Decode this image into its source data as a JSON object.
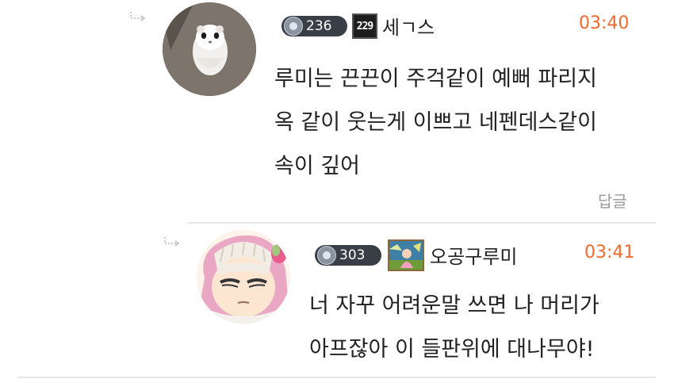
{
  "comments": [
    {
      "level": "236",
      "icon_badge_text": "229",
      "nickname": "세ㄱ스",
      "time": "03:40",
      "lines": [
        "루미는 끈끈이 주걱같이 예뻐 파리지",
        "옥 같이 웃는게 이쁘고 네펜데스같이",
        "속이 깊어"
      ],
      "reply_label": "답글"
    },
    {
      "level": "303",
      "nickname": "오공구루미",
      "time": "03:41",
      "lines": [
        "너 자꾸 어려운말 쓰면 나 머리가",
        "아프잖아 이 들판위에 대나무야!"
      ]
    }
  ],
  "colors": {
    "time": "#f26a2e",
    "level_badge": "#3a3f47",
    "reply_label": "#999999",
    "divider": "#e6e6e6"
  },
  "icons": [
    "reply-arrow-icon",
    "avatar-flying-squirrel",
    "avatar-anime-girl",
    "level-gem-icon",
    "square-badge-icon",
    "game-character-badge-icon"
  ]
}
